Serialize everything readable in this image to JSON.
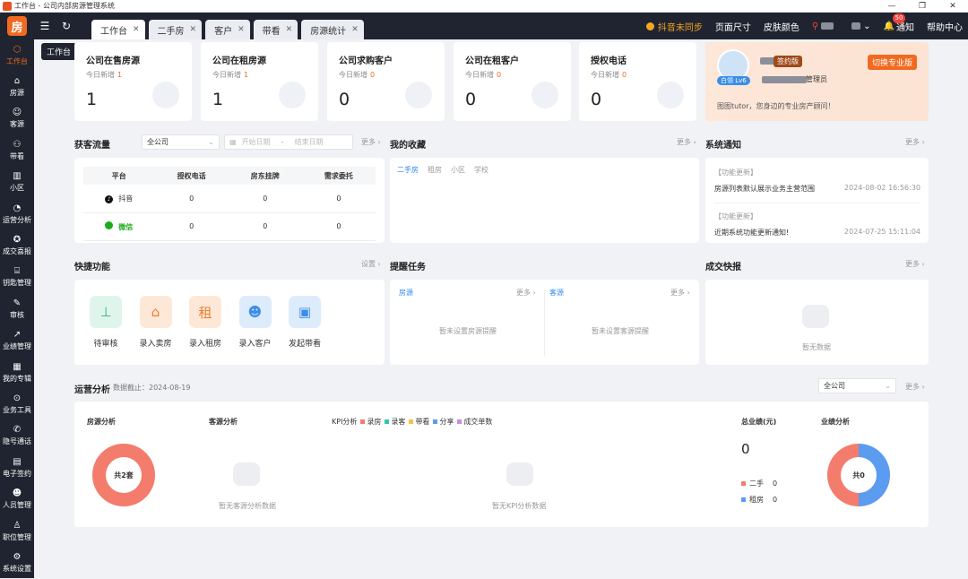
{
  "window": {
    "title": "工作台 - 公司内部房源管理系统",
    "controls": [
      "—",
      "❐",
      "✕"
    ]
  },
  "tabs": [
    {
      "label": "工作台",
      "active": true
    },
    {
      "label": "二手房",
      "active": false
    },
    {
      "label": "客户",
      "active": false
    },
    {
      "label": "带看",
      "active": false
    },
    {
      "label": "房源统计",
      "active": false
    }
  ],
  "topright": {
    "douyin_warn": "抖音未同步",
    "page_size": "页面尺寸",
    "skin": "皮肤颜色",
    "notify_label": "通知",
    "notify_count": "50",
    "help": "帮助中心"
  },
  "sidebar": [
    {
      "label": "工作台",
      "icon": "workbench-icon",
      "glyph": "⬡",
      "active": true
    },
    {
      "label": "房源",
      "icon": "home-icon",
      "glyph": "⌂"
    },
    {
      "label": "客源",
      "icon": "user-icon",
      "glyph": "☺"
    },
    {
      "label": "带看",
      "icon": "guide-icon",
      "glyph": "⚇"
    },
    {
      "label": "小区",
      "icon": "building-icon",
      "glyph": "▥"
    },
    {
      "label": "运营分析",
      "icon": "pie-chart-icon",
      "glyph": "◔"
    },
    {
      "label": "成交喜报",
      "icon": "medal-icon",
      "glyph": "✪"
    },
    {
      "label": "钥匙管理",
      "icon": "key-icon",
      "glyph": "⌸"
    },
    {
      "label": "审核",
      "icon": "audit-icon",
      "glyph": "✎"
    },
    {
      "label": "业绩管理",
      "icon": "trend-icon",
      "glyph": "↗"
    },
    {
      "label": "我的专辑",
      "icon": "album-icon",
      "glyph": "▦"
    },
    {
      "label": "业务工具",
      "icon": "location-icon",
      "glyph": "⊙"
    },
    {
      "label": "隐号通话",
      "icon": "phone-icon",
      "glyph": "✆"
    },
    {
      "label": "电子签约",
      "icon": "contract-icon",
      "glyph": "▤"
    },
    {
      "label": "人员管理",
      "icon": "people-icon",
      "glyph": "☻"
    },
    {
      "label": "职位管理",
      "icon": "position-icon",
      "glyph": "♙"
    },
    {
      "label": "系统设置",
      "icon": "settings-icon",
      "glyph": "⚙"
    }
  ],
  "tooltip": "工作台",
  "stats": [
    {
      "title": "公司在售房源",
      "sub": "今日新增",
      "add": "1",
      "value": "1"
    },
    {
      "title": "公司在租房源",
      "sub": "今日新增",
      "add": "1",
      "value": "1"
    },
    {
      "title": "公司求购客户",
      "sub": "今日新增",
      "add": "0",
      "value": "0"
    },
    {
      "title": "公司在租客户",
      "sub": "今日新增",
      "add": "0",
      "value": "0"
    },
    {
      "title": "授权电话",
      "sub": "今日新增",
      "add": "0",
      "value": "0"
    }
  ],
  "promo": {
    "level": "白领 Lv6",
    "edition": "签约版",
    "role": "管理员",
    "switch_btn": "切换专业版",
    "slogan": "图图tutor，您身边的专业房产顾问！"
  },
  "traffic": {
    "title": "获客流量",
    "company": "全公司",
    "start": "开始日期",
    "sep": "-",
    "end": "结束日期",
    "more": "更多 ›",
    "headers": [
      "平台",
      "授权电话",
      "房东挂牌",
      "需求委托"
    ],
    "rows": [
      {
        "platform": "抖音",
        "values": [
          "0",
          "0",
          "0"
        ]
      },
      {
        "platform": "微信",
        "values": [
          "0",
          "0",
          "0"
        ]
      }
    ]
  },
  "favorites": {
    "title": "我的收藏",
    "more": "更多 ›",
    "tabs": [
      "二手房",
      "租房",
      "小区",
      "学校"
    ]
  },
  "notices": {
    "title": "系统通知",
    "more": "更多 ›",
    "items": [
      {
        "tag": "【功能更新】",
        "text": "房源列表默认展示业务主营范围",
        "date": "2024-08-02 16:56:30"
      },
      {
        "tag": "【功能更新】",
        "text": "近期系统功能更新通知!",
        "date": "2024-07-25 15:11:04"
      }
    ]
  },
  "quick": {
    "title": "快捷功能",
    "settings": "设置 ›",
    "items": [
      {
        "label": "待审核",
        "icon": "stamp-icon",
        "glyph": "⊥",
        "bg": "#dff5ec",
        "fg": "#33b27a"
      },
      {
        "label": "录入卖房",
        "icon": "sell-house-icon",
        "glyph": "⌂",
        "bg": "#fde8d8",
        "fg": "#f07c2a"
      },
      {
        "label": "录入租房",
        "icon": "rent-house-icon",
        "glyph": "租",
        "bg": "#fde8d8",
        "fg": "#f07c2a"
      },
      {
        "label": "录入客户",
        "icon": "customer-icon",
        "glyph": "☻",
        "bg": "#dcecfb",
        "fg": "#3b8ee8"
      },
      {
        "label": "发起带看",
        "icon": "tour-icon",
        "glyph": "▣",
        "bg": "#dcecfb",
        "fg": "#3b8ee8"
      }
    ]
  },
  "reminders": {
    "title": "提醒任务",
    "house": {
      "label": "房源",
      "more": "更多 ›",
      "empty": "暂未设置房源提醒"
    },
    "client": {
      "label": "客源",
      "more": "更多 ›",
      "empty": "暂未设置客源提醒"
    }
  },
  "deals": {
    "title": "成交快报",
    "more": "更多 ›",
    "empty": "暂无数据"
  },
  "ops": {
    "title": "运营分析",
    "cutoff": "数据截止：2024-08-19",
    "company": "全公司",
    "more": "更多 ›",
    "house_title": "房源分析",
    "house_total": "共2套",
    "client_title": "客源分析",
    "client_empty": "暂无客源分析数据",
    "kpi_title": "KPI分析",
    "kpi_legend": [
      {
        "name": "录房",
        "color": "#f47c6c"
      },
      {
        "name": "录客",
        "color": "#33c6b0"
      },
      {
        "name": "带看",
        "color": "#f5c242"
      },
      {
        "name": "分享",
        "color": "#5b9bf0"
      },
      {
        "name": "成交单数",
        "color": "#c88ae8"
      }
    ],
    "kpi_empty": "暂无KPI分析数据",
    "total_title": "总业绩(元)",
    "total_value": "0",
    "second_label": "二手",
    "second_value": "0",
    "rent_label": "租房",
    "rent_value": "0",
    "perf_title": "业绩分析",
    "perf_total": "共0"
  },
  "colors": {
    "accent": "#f26a21",
    "sidebar": "#1f2430",
    "blue": "#2d8cf0",
    "pie_red": "#f47c6c",
    "pie_blue": "#5b9bf0"
  }
}
